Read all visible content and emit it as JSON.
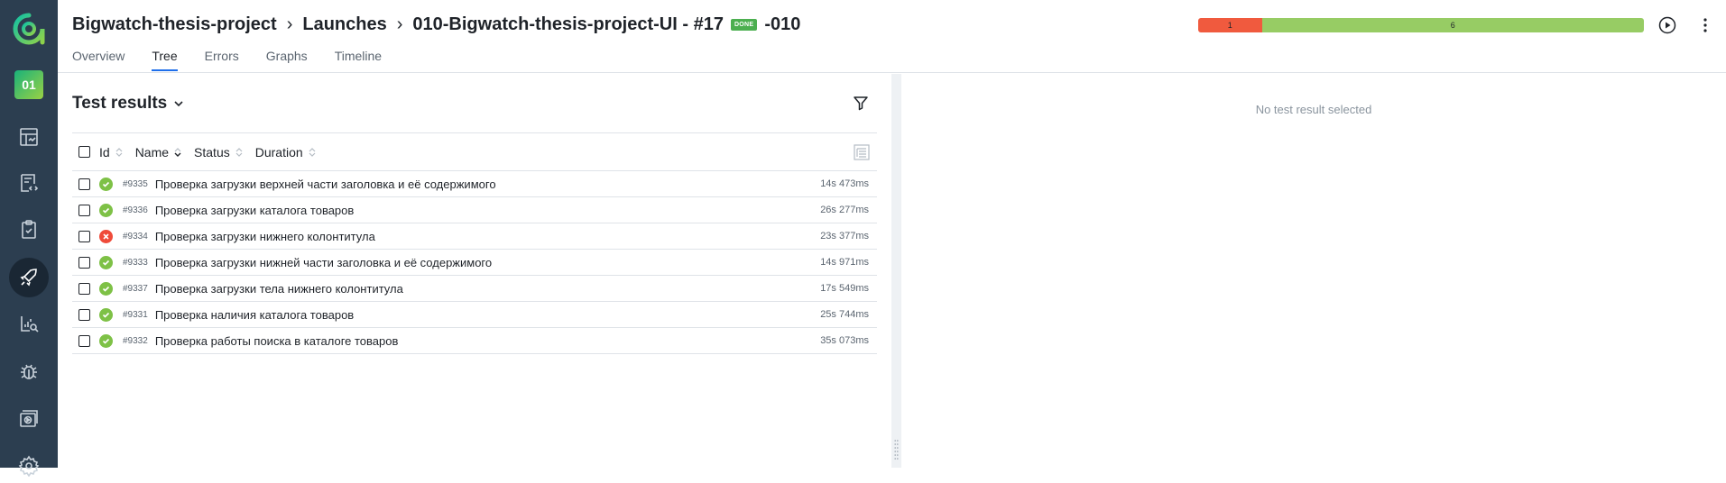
{
  "sidebar": {
    "project_badge": "01",
    "items": [
      {
        "icon": "dashboard-icon"
      },
      {
        "icon": "test-cases-icon"
      },
      {
        "icon": "test-plans-icon"
      },
      {
        "icon": "launches-icon",
        "active": true
      },
      {
        "icon": "analytics-icon"
      },
      {
        "icon": "defects-icon"
      },
      {
        "icon": "jobs-icon"
      },
      {
        "icon": "settings-icon"
      }
    ]
  },
  "header": {
    "breadcrumb": {
      "project": "Bigwatch-thesis-project",
      "section": "Launches",
      "launch": "010-Bigwatch-thesis-project-UI - #17",
      "status_badge": "DONE",
      "suffix": "-010"
    },
    "tabs": [
      {
        "label": "Overview"
      },
      {
        "label": "Tree",
        "active": true
      },
      {
        "label": "Errors"
      },
      {
        "label": "Graphs"
      },
      {
        "label": "Timeline"
      }
    ],
    "progress": {
      "failed": 1,
      "passed": 6,
      "failed_color": "#f05a3e",
      "passed_color": "#97cc64"
    }
  },
  "results": {
    "title": "Test results",
    "columns": [
      "Id",
      "Name",
      "Status",
      "Duration"
    ],
    "rows": [
      {
        "status": "passed",
        "id": "#9335",
        "name": "Проверка загрузки верхней части заголовка и её содержимого",
        "duration": "14s 473ms"
      },
      {
        "status": "passed",
        "id": "#9336",
        "name": "Проверка загрузки каталога товаров",
        "duration": "26s 277ms"
      },
      {
        "status": "failed",
        "id": "#9334",
        "name": "Проверка загрузки нижнего колонтитула",
        "duration": "23s 377ms"
      },
      {
        "status": "passed",
        "id": "#9333",
        "name": "Проверка загрузки нижней части заголовка и её содержимого",
        "duration": "14s 971ms"
      },
      {
        "status": "passed",
        "id": "#9337",
        "name": "Проверка загрузки тела нижнего колонтитула",
        "duration": "17s 549ms"
      },
      {
        "status": "passed",
        "id": "#9331",
        "name": "Проверка наличия каталога товаров",
        "duration": "25s 744ms"
      },
      {
        "status": "passed",
        "id": "#9332",
        "name": "Проверка работы поиска в каталоге товаров",
        "duration": "35s 073ms"
      }
    ]
  },
  "detail": {
    "empty_message": "No test result selected"
  }
}
